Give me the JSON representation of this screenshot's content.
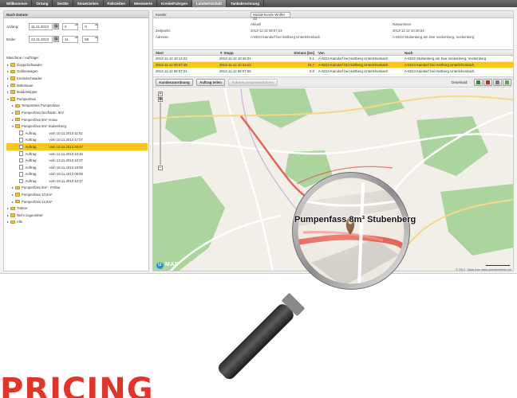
{
  "nav": {
    "tabs": [
      {
        "label": "Willkommen",
        "active": false
      },
      {
        "label": "Ortung",
        "active": false
      },
      {
        "label": "Geräte",
        "active": false
      },
      {
        "label": "Steuerzeiten",
        "active": false
      },
      {
        "label": "Fahrzeiten",
        "active": false
      },
      {
        "label": "Messwerte",
        "active": false
      },
      {
        "label": "Kreide/Fahrgen",
        "active": false
      },
      {
        "label": "Landwirtschaft",
        "active": true
      },
      {
        "label": "Tankabrechnung",
        "active": false
      }
    ]
  },
  "left": {
    "header": "Nach Datum:",
    "start_label": "Anfang:",
    "start_date": "11.11.2013",
    "start_hour": "0",
    "start_min": "0",
    "end_label": "Ende:",
    "end_date": "22.11.2013",
    "end_hour": "11",
    "end_min": "55",
    "section_label": "Maschine / Aufträge:",
    "tree": [
      {
        "label": "Doppelschwader",
        "level": 0,
        "type": "folder",
        "arrow": "▸"
      },
      {
        "label": "Güldenwagen",
        "level": 0,
        "type": "folder",
        "arrow": "▸"
      },
      {
        "label": "Kreiselschwader",
        "level": 0,
        "type": "folder",
        "arrow": "▸"
      },
      {
        "label": "Mähdrauer",
        "level": 0,
        "type": "folder",
        "arrow": "▸"
      },
      {
        "label": "Muldenkipper",
        "level": 0,
        "type": "folder",
        "arrow": "▸"
      },
      {
        "label": "Pumpenfass",
        "level": 0,
        "type": "folder",
        "arrow": "▾"
      },
      {
        "label": "Temporäres Pumpenfass",
        "level": 1,
        "type": "folder",
        "arrow": "▸"
      },
      {
        "label": "Pumpenfass Dechantn. 8m³",
        "level": 1,
        "type": "folder",
        "arrow": "▸"
      },
      {
        "label": "Pumpenfass 8m³ Vorau",
        "level": 1,
        "type": "folder",
        "arrow": "▸"
      },
      {
        "label": "Pumpenfass 8m³ Stubenberg",
        "level": 1,
        "type": "folder",
        "arrow": "▾"
      },
      {
        "label": "Auftrag",
        "when": "vom 10.11.2013 11:02",
        "level": 2,
        "type": "doc"
      },
      {
        "label": "Auftrag",
        "when": "vom 10.11.2013 17:07",
        "level": 2,
        "type": "doc"
      },
      {
        "label": "Auftrag",
        "when": "vom 12.11.2013 08:07",
        "level": 2,
        "type": "doc",
        "selected": true
      },
      {
        "label": "Auftrag",
        "when": "vom 12.11.2013 10:46",
        "level": 2,
        "type": "doc"
      },
      {
        "label": "Auftrag",
        "when": "vom 13.11.2013 10:37",
        "level": 2,
        "type": "doc"
      },
      {
        "label": "Auftrag",
        "when": "vom 18.11.2013 15:58",
        "level": 2,
        "type": "doc"
      },
      {
        "label": "Auftrag",
        "when": "vom 19.11.2013 06:55",
        "level": 2,
        "type": "doc"
      },
      {
        "label": "Auftrag",
        "when": "vom 19.11.2013 10:17",
        "level": 2,
        "type": "doc"
      },
      {
        "label": "Pumpenfass 8m³ - Pöllau",
        "level": 1,
        "type": "folder",
        "arrow": "▸"
      },
      {
        "label": "Pumpenfass 10,5m³",
        "level": 1,
        "type": "folder",
        "arrow": "▸"
      },
      {
        "label": "Pumpenfass 12,5m³",
        "level": 1,
        "type": "folder",
        "arrow": "▸"
      },
      {
        "label": "Traktor",
        "level": 0,
        "type": "folder",
        "arrow": "▸"
      },
      {
        "label": "Nicht zugeordnet",
        "level": 0,
        "type": "folder",
        "arrow": "▸"
      },
      {
        "label": "Alle",
        "level": 0,
        "type": "folder",
        "arrow": "▸"
      }
    ]
  },
  "right": {
    "kunde_label": "Kunde:",
    "kunde_value": "Musterkunde Wolfer 33",
    "info": {
      "col_start": "Aktuell",
      "col_end": "Ratsummen",
      "zeitpunkt_label": "Zeitpunkt:",
      "zeitpunkt_start": "2013-11-12 08:07:24",
      "zeitpunkt_end": "2013-11-12 10:46:34",
      "adresse_label": "Adresse:",
      "adresse_start": "A-8224 Kaindorf bei Hartberg Unterlehenbach",
      "adresse_end": "A-8224 Stubenberg am See Vockenberg, Vockenberg"
    },
    "table": {
      "headers": [
        "Start",
        "▼ Stopp",
        "Distanz [km]",
        "Von",
        "Nach"
      ],
      "rows": [
        {
          "start": "2013-11-12 10:14:22",
          "stopp": "2013-11-12 10:46:34",
          "dist": "0,1",
          "von": "A-8224 Kaindorf bei Hartberg Unterlehenbach",
          "nach": "A-8222 Stubenberg am See Vockenberg, Vockenberg",
          "selected": false
        },
        {
          "start": "2013-11-12 08:07:25",
          "stopp": "2013-11-12 10:14:22",
          "dist": "15,7",
          "von": "A-8224 Kaindorf bei Hartberg Unterlehenbach",
          "nach": "A-8224 Kaindorf bei Hartberg Unterlehenbach",
          "selected": true
        },
        {
          "start": "2013-11-12 08:07:24",
          "stopp": "2013-11-12 08:07:55",
          "dist": "0,0",
          "von": "A-8224 Kaindorf bei Hartberg Unterlehenbach",
          "nach": "A-8224 Kaindorf bei Hartberg Unterlehenbach",
          "selected": false
        }
      ]
    },
    "buttons": {
      "kundenzuordnung": "Kundenzuordnung",
      "auftrag_teilen": "Auftrag teilen",
      "disabled": "Fahrten zusammenführen",
      "download_label": "Download:"
    },
    "download_icons": [
      {
        "name": "excel-icon",
        "color": "#2e8b3e"
      },
      {
        "name": "pdf-icon",
        "color": "#c62828"
      },
      {
        "name": "print-icon",
        "color": "#7a7a7a"
      },
      {
        "name": "map-export-icon",
        "color": "#4caf50"
      }
    ]
  },
  "map": {
    "magnifier_label": "Pumpenfass 8m³ Stubenberg",
    "logo": "MAP",
    "copyright": "© 2013 · Maps from www.openstreetmap.org"
  },
  "heading": "PRICING"
}
